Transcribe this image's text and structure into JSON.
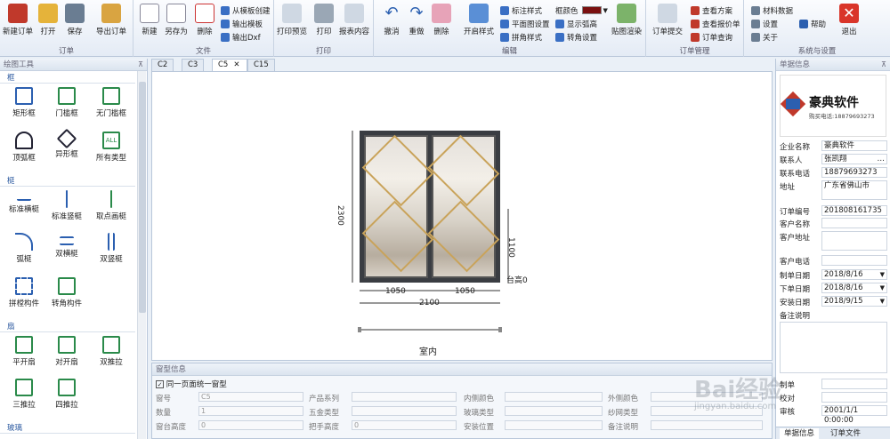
{
  "ribbon": {
    "groups": [
      {
        "label": "订单",
        "buttons": [
          "新建订单",
          "打开",
          "保存",
          "导出订单"
        ]
      },
      {
        "label": "文件",
        "buttons": [
          "新建",
          "另存为",
          "删除"
        ],
        "small": [
          "从模板创建",
          "输出模板",
          "输出Dxf"
        ]
      },
      {
        "label": "打印",
        "buttons": [
          "打印预览",
          "打印",
          "报表内容"
        ]
      },
      {
        "label": "编辑",
        "buttons": [
          "撤消",
          "重做",
          "删除",
          "开启样式"
        ],
        "small": [
          "标注样式",
          "平面图设置",
          "拼角样式",
          "框颜色",
          "显示弧高",
          "转角设置"
        ],
        "extra": "贴图渲染"
      },
      {
        "label": "订单管理",
        "buttons": [
          "订单提交"
        ],
        "small": [
          "查看方案",
          "查看报价单",
          "订单查询"
        ]
      },
      {
        "label": "系统与设置",
        "small": [
          "材料数据",
          "设置",
          "关于",
          "帮助"
        ],
        "buttons": [
          "退出"
        ]
      }
    ],
    "frame_color": "#7a1010"
  },
  "sidebar": {
    "title": "绘图工具",
    "sections": [
      {
        "label": "框",
        "items": [
          "矩形框",
          "门槛框",
          "无门槛框",
          "顶弧框",
          "异形框",
          "所有类型"
        ]
      },
      {
        "label": "梃",
        "items": [
          "标准横梃",
          "标准竖梃",
          "取点画梃",
          "弧梃",
          "双横梃",
          "双竖梃",
          "拼樘构件",
          "转角构件"
        ]
      },
      {
        "label": "扇",
        "items": [
          "平开扇",
          "对开扇",
          "双推拉",
          "三推拉",
          "四推拉"
        ]
      },
      {
        "label": "玻璃",
        "items": []
      }
    ]
  },
  "tabs": [
    "C2",
    "C3",
    "C5",
    "C15"
  ],
  "active_tab": "C5",
  "drawing": {
    "height": "2300",
    "sub_height": "1100",
    "sill": "台高0",
    "width_left": "1050",
    "width_right": "1050",
    "width_total": "2100",
    "indoor": "室内"
  },
  "window_info": {
    "title": "窗型信息",
    "checkbox": "同一页面统一窗型",
    "fields": [
      [
        "窗号",
        "C5"
      ],
      [
        "产品系列",
        ""
      ],
      [
        "内侧颜色",
        ""
      ],
      [
        "外侧颜色",
        ""
      ],
      [
        "数量",
        "1"
      ],
      [
        "五金类型",
        ""
      ],
      [
        "玻璃类型",
        ""
      ],
      [
        "纱网类型",
        ""
      ],
      [
        "窗台高度",
        "0"
      ],
      [
        "把手高度",
        "0"
      ],
      [
        "安装位置",
        ""
      ],
      [
        "备注说明",
        ""
      ]
    ]
  },
  "right_panel": {
    "title": "单据信息",
    "logo_text": "豪典软件",
    "logo_sub": "购买电话:18879693273",
    "fields": [
      [
        "企业名称",
        "豪典软件"
      ],
      [
        "联系人",
        "张凯翔"
      ],
      [
        "联系电话",
        "18879693273"
      ],
      [
        "地址",
        "广东省佛山市"
      ],
      [
        "订单编号",
        "201808161735"
      ],
      [
        "客户名称",
        ""
      ],
      [
        "客户地址",
        ""
      ],
      [
        "客户电话",
        ""
      ],
      [
        "制单日期",
        "2018/8/16"
      ],
      [
        "下单日期",
        "2018/8/16"
      ],
      [
        "安装日期",
        "2018/9/15"
      ],
      [
        "备注说明",
        ""
      ],
      [
        "制单",
        ""
      ],
      [
        "校对",
        ""
      ],
      [
        "审核",
        "2001/1/1 0:00:00"
      ]
    ],
    "tabs": [
      "单据信息",
      "订单文件"
    ]
  },
  "watermark": {
    "main": "Bai经验",
    "sub": "jingyan.baidu.com"
  }
}
